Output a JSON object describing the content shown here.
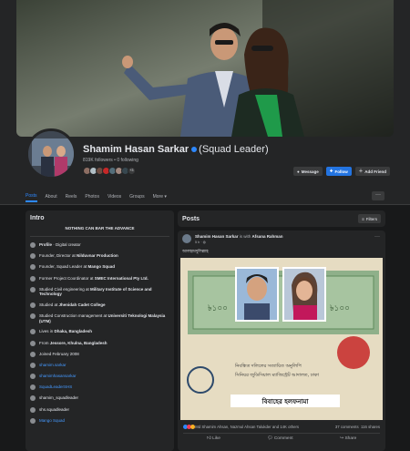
{
  "profile": {
    "name": "Shamim Hasan Sarkar",
    "subtitle": "(Squad Leader)",
    "followers": "819K followers • 0 following",
    "friend_count": "+3"
  },
  "actions": {
    "message": "Message",
    "follow": "Follow",
    "add_friend": "Add Friend"
  },
  "tabs": [
    "Posts",
    "About",
    "Reels",
    "Photos",
    "Videos",
    "Groups",
    "More"
  ],
  "intro": {
    "title": "Intro",
    "bio": "NOTHING CAN BAR THE ADVANCE",
    "items": [
      {
        "icon": "info-icon",
        "prefix": "Profile",
        "text": " · Digital creator"
      },
      {
        "icon": "briefcase-icon",
        "prefix": "",
        "text": "Founder, Director at ",
        "bold": "Nilduvnar Production"
      },
      {
        "icon": "briefcase-icon",
        "prefix": "",
        "text": "Founder, Squad Leader at ",
        "bold": "Mango Squad"
      },
      {
        "icon": "briefcase-icon",
        "prefix": "",
        "text": "Former Project Coordinator at ",
        "bold": "SMEC International Pty Ltd."
      },
      {
        "icon": "graduation-cap-icon",
        "prefix": "",
        "text": "Studied Civil engineering at ",
        "bold": "Military Institute of Science and Technology"
      },
      {
        "icon": "graduation-cap-icon",
        "prefix": "",
        "text": "Studied at ",
        "bold": "Jhenidah Cadet College"
      },
      {
        "icon": "graduation-cap-icon",
        "prefix": "",
        "text": "Studied Construction management at ",
        "bold": "Universiti Teknologi Malaysia (UTM)"
      },
      {
        "icon": "home-icon",
        "prefix": "",
        "text": "Lives in ",
        "bold": "Dhaka, Bangladesh"
      },
      {
        "icon": "location-pin-icon",
        "prefix": "",
        "text": "From ",
        "bold": "Jessore, Khulna, Bangladesh"
      },
      {
        "icon": "clock-icon",
        "prefix": "",
        "text": "Joined February 2008",
        "bold": ""
      }
    ],
    "links": [
      {
        "icon": "instagram-icon",
        "text": "shamim.sarkar",
        "link": true
      },
      {
        "icon": "instagram-icon",
        "text": "shamimhasansarkar",
        "link": true
      },
      {
        "icon": "twitter-icon",
        "text": "SquadLeaderSHS",
        "link": true
      },
      {
        "icon": "tiktok-icon",
        "text": "shamim_squadleader",
        "link": false
      },
      {
        "icon": "tiktok-icon",
        "text": "shs.squadleader",
        "link": false
      },
      {
        "icon": "link-icon",
        "text": "Mango Squad",
        "link": true
      }
    ]
  },
  "posts": {
    "title": "Posts",
    "filters": "Filters",
    "author": "Shamim Hasan Sarkar",
    "with_text": " is with ",
    "tagged": "Afsana Rahman",
    "time": "5 h ·",
    "caption": "আলহামদুলিল্লাহ",
    "image_title": "বিবাহের হলফনামা",
    "reactions_text": "Md Shamim Ahsan, Nazmul Ahsan Talukder and 14K others",
    "comments": "37 comments",
    "shares": "116 shares",
    "like": "Like",
    "comment": "Comment",
    "share": "Share"
  },
  "colors": {
    "accent": "#2d88ff",
    "follow_button": "#2374e1",
    "panel": "#242526",
    "background": "#18191a"
  }
}
